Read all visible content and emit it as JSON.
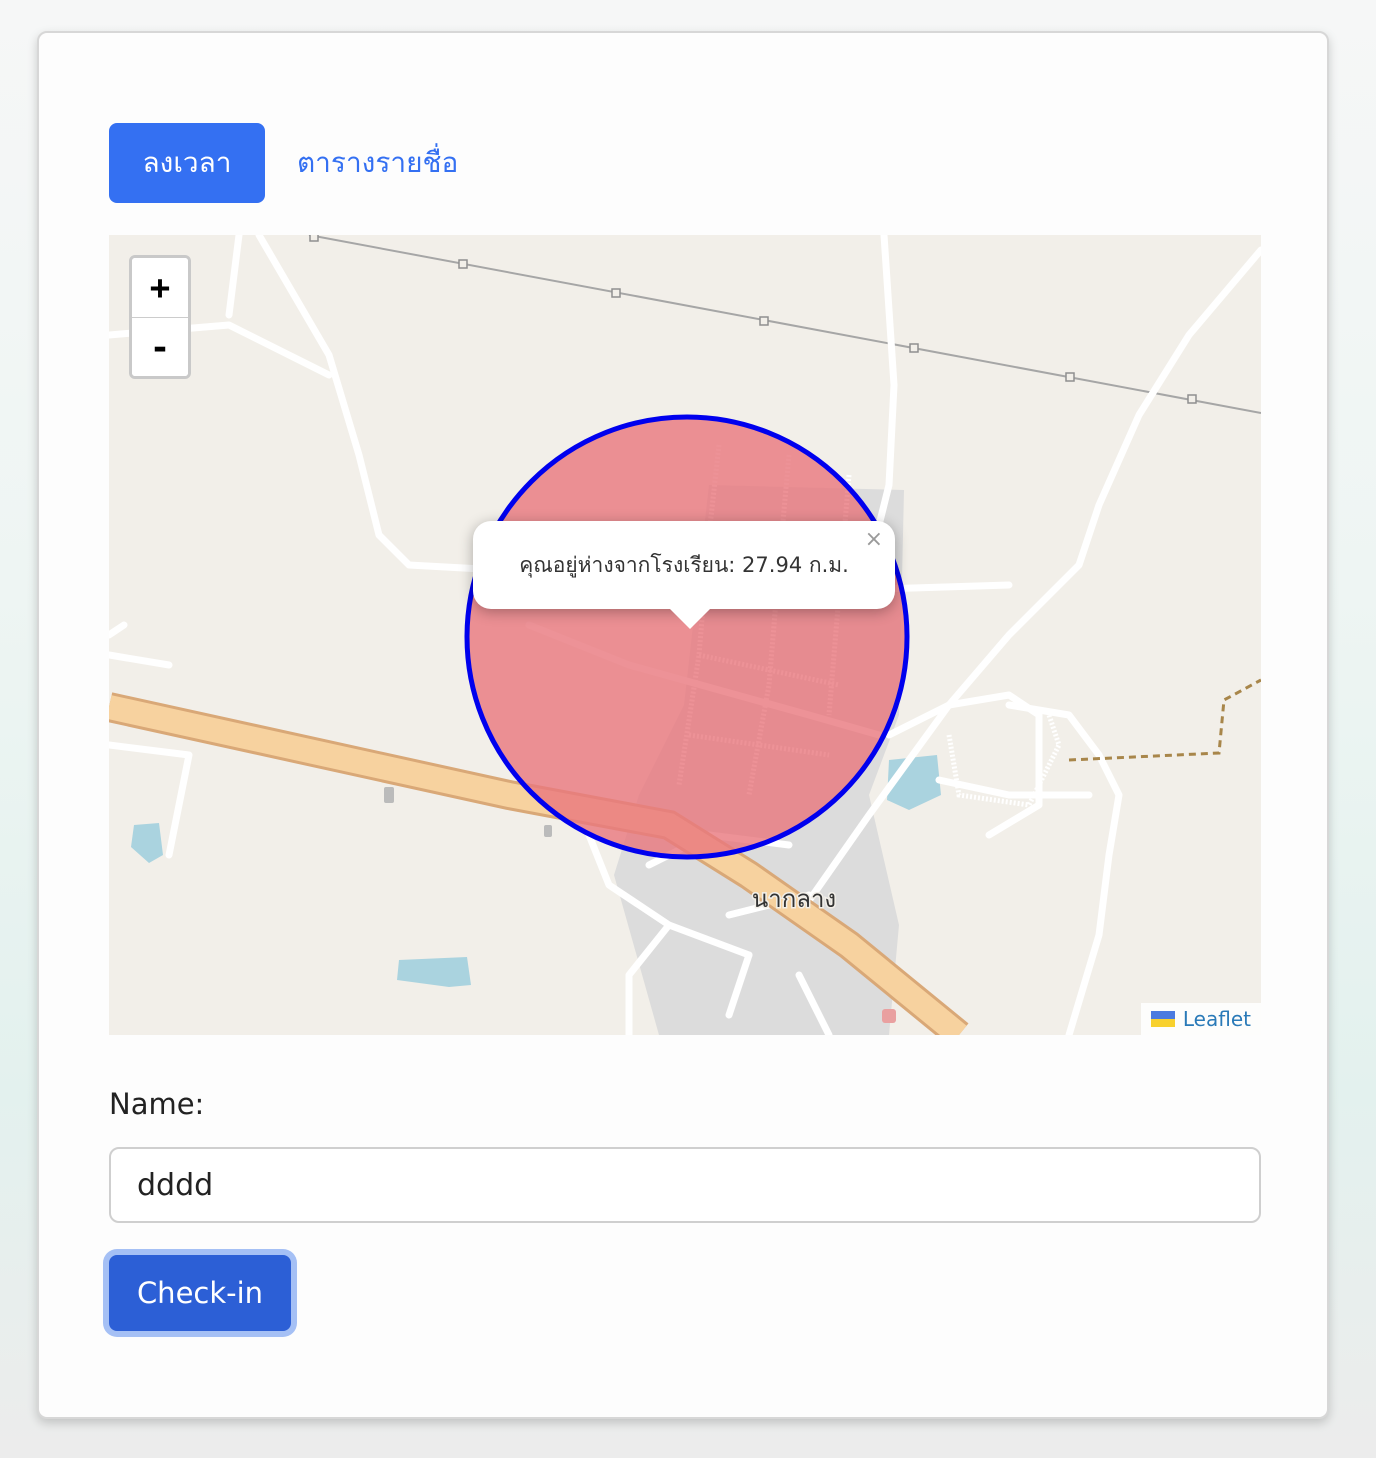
{
  "tabs": {
    "active_label": "ลงเวลา",
    "link_label": "ตารางรายชื่อ"
  },
  "map": {
    "zoom_in": "+",
    "zoom_out": "-",
    "popup_text": "คุณอยู่ห่างจากโรงเรียน: 27.94 ก.ม.",
    "popup_close": "×",
    "place_label": "นากลาง",
    "attribution": "Leaflet"
  },
  "form": {
    "name_label": "Name:",
    "name_value": "dddd",
    "submit_label": "Check-in"
  },
  "colors": {
    "primary": "#3470f2",
    "circle_fill": "#e8777d",
    "circle_stroke": "#0000ee"
  }
}
